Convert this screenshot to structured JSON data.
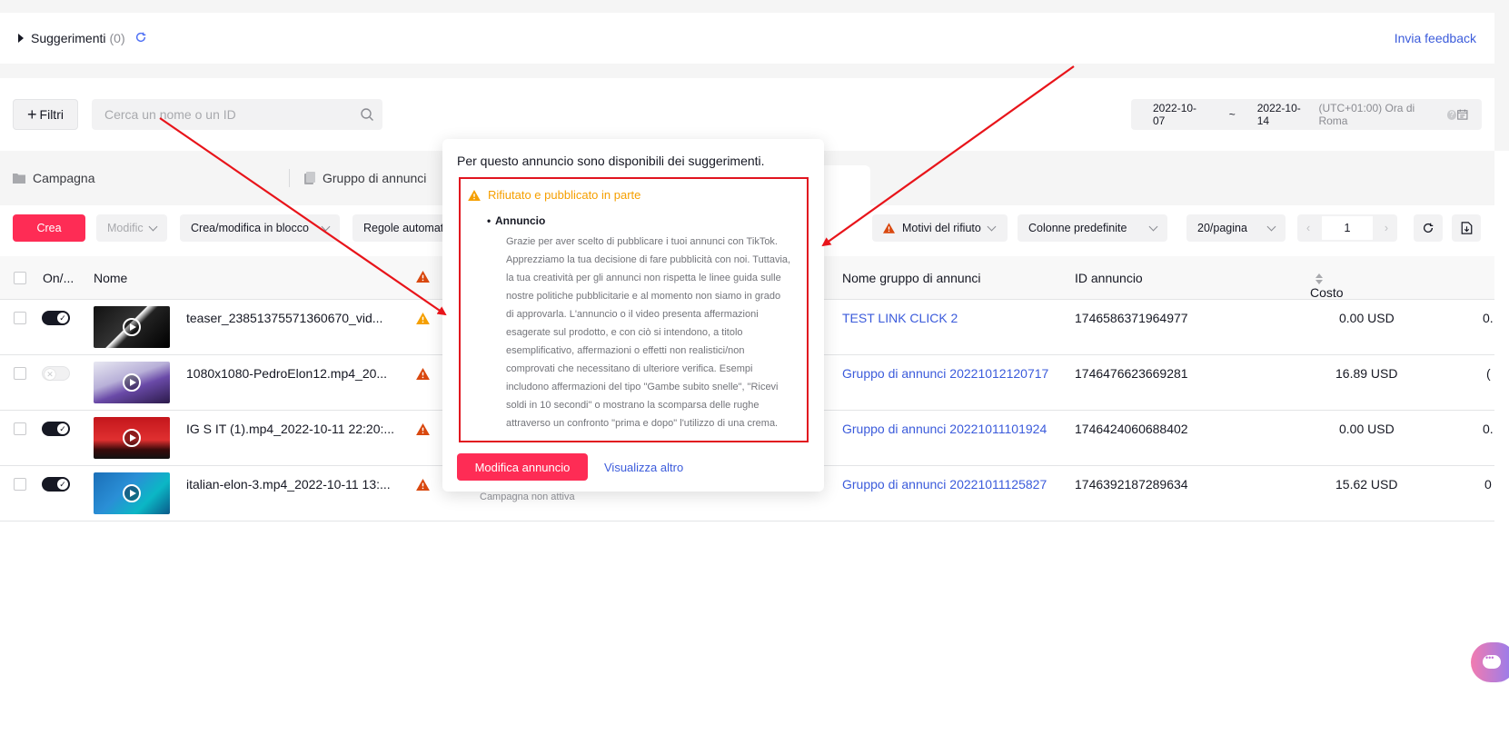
{
  "suggestions": {
    "title": "Suggerimenti",
    "count": "(0)",
    "feedback_link": "Invia feedback"
  },
  "filters": {
    "filter_button": "Filtri",
    "search_placeholder": "Cerca un nome o un ID",
    "date_start": "2022-10-07",
    "date_sep": "~",
    "date_end": "2022-10-14",
    "timezone": "(UTC+01:00) Ora di Roma"
  },
  "tabs": {
    "campaign": "Campagna",
    "adgroup": "Gruppo di annunci"
  },
  "toolbar": {
    "create": "Crea",
    "modify": "Modific",
    "bulk": "Crea/modifica in blocco",
    "rules": "Regole automati",
    "rejection_reasons": "Motivi del rifiuto",
    "columns": "Colonne predefinite",
    "per_page": "20/pagina",
    "page_number": "1"
  },
  "table": {
    "headers": {
      "onoff": "On/...",
      "name": "Nome",
      "adgroup_name": "Nome gruppo di annunci",
      "ad_id": "ID annuncio",
      "total_cost": "Costo totale"
    },
    "rows": [
      {
        "enabled": true,
        "name": "teaser_23851375571360670_vid...",
        "warning": "yellow",
        "adgroup": "TEST LINK CLICK 2",
        "ad_id": "1746586371964977",
        "cost": "0.00 USD",
        "extra": "0."
      },
      {
        "enabled": false,
        "name": "1080x1080-PedroElon12.mp4_20...",
        "warning": "red",
        "adgroup": "Gruppo di annunci 20221012120717",
        "ad_id": "1746476623669281",
        "cost": "16.89 USD",
        "extra": "("
      },
      {
        "enabled": true,
        "name": "IG S IT (1).mp4_2022-10-11 22:20:...",
        "warning": "red",
        "adgroup": "Gruppo di annunci 20221011101924",
        "ad_id": "1746424060688402",
        "cost": "0.00 USD",
        "extra": "0."
      },
      {
        "enabled": true,
        "name": "italian-elon-3.mp4_2022-10-11 13:...",
        "warning": "red",
        "adgroup": "Gruppo di annunci 20221011125827",
        "ad_id": "1746392187289634",
        "cost": "15.62 USD",
        "extra": "0"
      }
    ],
    "row4_status": "Campagna non attiva"
  },
  "popover": {
    "title": "Per questo annuncio sono disponibili dei suggerimenti.",
    "status": "Rifiutato e pubblicato in parte",
    "subtitle": "Annuncio",
    "lines": [
      "Grazie per aver scelto di pubblicare i tuoi annunci con TikTok.",
      "Apprezziamo la tua decisione di fare pubblicità con noi. Tuttavia,",
      "la tua creatività per gli annunci non rispetta le linee guida sulle",
      "nostre politiche pubblicitarie e al momento non siamo in grado",
      "di approvarla. L'annuncio o il video presenta affermazioni",
      "esagerate sul prodotto, e con ciò si intendono, a titolo",
      "esemplificativo, affermazioni o effetti non realistici/non",
      "comprovati che necessitano di ulteriore verifica. Esempi",
      "includono affermazioni del tipo \"Gambe subito snelle\", \"Ricevi",
      "soldi in 10 secondi\" o mostrano la scomparsa delle rughe",
      "attraverso un confronto \"prima e dopo\" l'utilizzo di una crema."
    ],
    "edit_button": "Modifica annuncio",
    "more_link": "Visualizza altro"
  },
  "colors": {
    "primary": "#fe2c55",
    "link": "#3b5bdb",
    "warning": "#f59f00",
    "danger": "#e1141f",
    "annotation": "#e8141a"
  }
}
